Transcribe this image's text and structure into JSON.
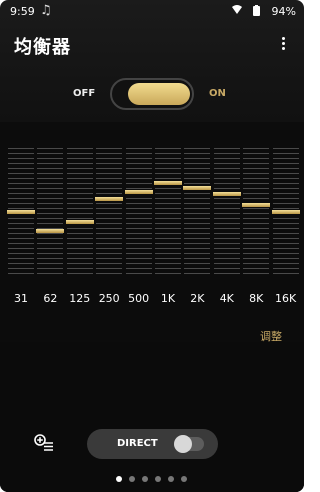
{
  "status_bar": {
    "time": "9:59",
    "battery": "94%"
  },
  "app_bar": {
    "title": "均衡器"
  },
  "master_switch": {
    "off_label": "OFF",
    "on_label": "ON",
    "state": "on"
  },
  "equalizer": {
    "bands": [
      {
        "label": "31",
        "level": 0.52
      },
      {
        "label": "62",
        "level": 0.38
      },
      {
        "label": "125",
        "level": 0.45
      },
      {
        "label": "250",
        "level": 0.62
      },
      {
        "label": "500",
        "level": 0.68
      },
      {
        "label": "1K",
        "level": 0.75
      },
      {
        "label": "2K",
        "level": 0.71
      },
      {
        "label": "4K",
        "level": 0.66
      },
      {
        "label": "8K",
        "level": 0.58
      },
      {
        "label": "16K",
        "level": 0.52
      }
    ],
    "adjust_label": "调整"
  },
  "direct": {
    "label": "DIRECT",
    "state": "off"
  },
  "pager": {
    "count": 6,
    "active": 0
  },
  "colors": {
    "accent_gold": "#c9aa66",
    "background": "#0b0b0b"
  }
}
